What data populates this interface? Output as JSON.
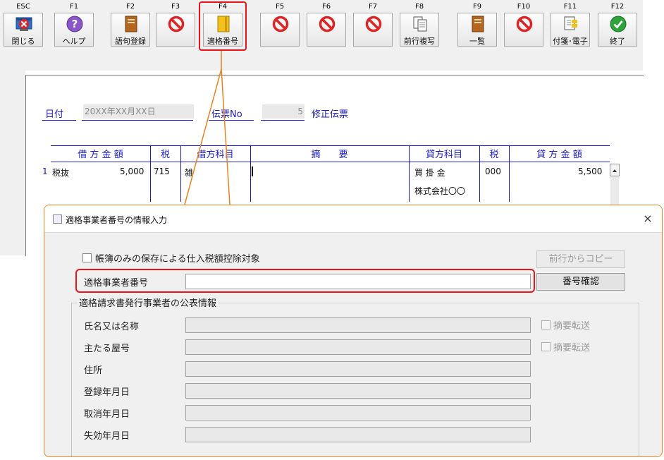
{
  "toolbar": {
    "keys": [
      {
        "key": "ESC",
        "label": "閉じる"
      },
      {
        "key": "F1",
        "label": "ヘルプ"
      },
      {
        "key": "F2",
        "label": "語句登録"
      },
      {
        "key": "F3",
        "label": ""
      },
      {
        "key": "F4",
        "label": "適格番号"
      },
      {
        "key": "F5",
        "label": ""
      },
      {
        "key": "F6",
        "label": ""
      },
      {
        "key": "F7",
        "label": ""
      },
      {
        "key": "F8",
        "label": "前行複写"
      },
      {
        "key": "F9",
        "label": "一覧"
      },
      {
        "key": "F10",
        "label": ""
      },
      {
        "key": "F11",
        "label": "付箋･電子"
      },
      {
        "key": "F12",
        "label": "終了"
      }
    ]
  },
  "slip": {
    "date_label": "日付",
    "date_value": "20XX年XX月XX日",
    "slip_no_label": "伝票No",
    "slip_no_value": "5",
    "mode_label": "修正伝票",
    "headers": {
      "debit_amount": "借 方 金 額",
      "debit_tax": "税",
      "debit_account": "借方科目",
      "summary": "摘　　要",
      "credit_account": "貸方科目",
      "credit_tax": "税",
      "credit_amount": "貸 方 金 額"
    },
    "row": {
      "line_no": "1",
      "tax_mode": "税抜",
      "debit_amount": "5,000",
      "debit_tax_code": "715",
      "debit_account": "雑",
      "credit_account": "買 掛 金",
      "credit_subaccount": "株式会社〇〇",
      "credit_tax_code": "000",
      "credit_amount": "5,500"
    }
  },
  "dialog": {
    "title": "適格事業者番号の情報入力",
    "close": "×",
    "books_only_label": "帳簿のみの保存による仕入税額控除対象",
    "copy_prev_button": "前行からコピー",
    "reg_no_label": "適格事業者番号",
    "reg_no_value": "",
    "confirm_button": "番号確認",
    "group_title": "適格請求書発行事業者の公表情報",
    "fields": [
      {
        "label": "氏名又は名称",
        "checkbox": "摘要転送"
      },
      {
        "label": "主たる屋号",
        "checkbox": "摘要転送"
      },
      {
        "label": "住所",
        "checkbox": ""
      },
      {
        "label": "登録年月日",
        "checkbox": ""
      },
      {
        "label": "取消年月日",
        "checkbox": ""
      },
      {
        "label": "失効年月日",
        "checkbox": ""
      }
    ]
  },
  "colors": {
    "highlight": "#e5151c",
    "callout": "#e8821f",
    "accent_blue": "#1a1ac8"
  }
}
